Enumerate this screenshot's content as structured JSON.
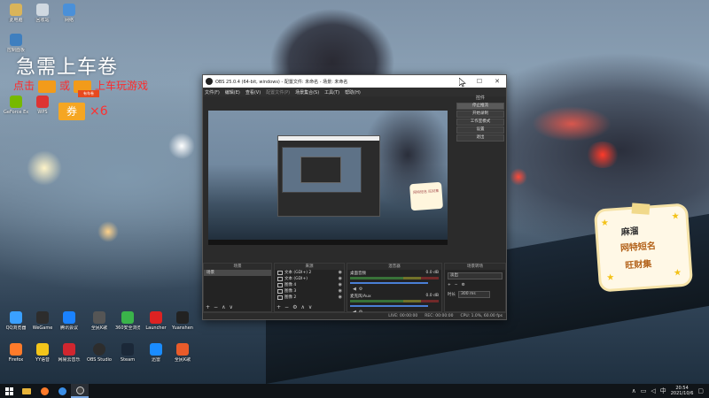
{
  "desktop": {
    "icons": [
      {
        "label": "此电脑",
        "color": "#d9b45a"
      },
      {
        "label": "回收站",
        "color": "#cfd8e0"
      },
      {
        "label": "网络",
        "color": "#4a90d9"
      },
      {
        "label": "控制面板",
        "color": "#3f7fbf"
      },
      {
        "label": "GeForce Experience",
        "color": "#76b900"
      },
      {
        "label": "WPS",
        "color": "#d33"
      },
      {
        "label": "QQ浏览器",
        "color": "#3aa0ff"
      },
      {
        "label": "WeGame",
        "color": "#2d2d2d"
      },
      {
        "label": "腾讯会议",
        "color": "#1a82ff"
      },
      {
        "label": "全民K歌",
        "color": "#555"
      },
      {
        "label": "360安全浏览器",
        "color": "#3ab34a"
      },
      {
        "label": "Launcher",
        "color": "#d22"
      },
      {
        "label": "Yuanshen",
        "color": "#222"
      },
      {
        "label": "Firefox",
        "color": "#ff7b2a"
      },
      {
        "label": "YY语音",
        "color": "#f3c51a"
      },
      {
        "label": "网易云音乐",
        "color": "#d0262f"
      },
      {
        "label": "OBS Studio",
        "color": "#2d2d2d"
      },
      {
        "label": "Steam",
        "color": "#1b2838"
      },
      {
        "label": "迅雷",
        "color": "#1a8cff"
      },
      {
        "label": "全民K歌",
        "color": "#e95b2a"
      }
    ]
  },
  "promo": {
    "title": "急需上车卷",
    "line_left": "点击",
    "line_mid": "或",
    "line_right": "上车玩游戏",
    "badge_sub": "有车卷",
    "ticket": "券",
    "count": "×6"
  },
  "sticker": {
    "line1": "麻溜",
    "line2": "网特短名",
    "line3": "旺财集"
  },
  "obs": {
    "title": "OBS 25.0.4 (64-bit, windows) - 配置文件: 未命名 - 场景: 未命名",
    "menu": [
      "文件(F)",
      "编辑(E)",
      "查看(V)",
      "配置文件(P)",
      "场景集合(S)",
      "工具(T)",
      "帮助(H)"
    ],
    "controls_header": "控件",
    "controls": [
      "停止推流",
      "开始录制",
      "工作室模式",
      "设置",
      "退出"
    ],
    "scenes": {
      "header": "场景",
      "items": [
        "场景"
      ]
    },
    "sources": {
      "header": "来源",
      "items": [
        "文本 (GDI+) 2",
        "文本 (GDI+)",
        "图像 4",
        "图像 3",
        "图像 2",
        "图像"
      ]
    },
    "mixer": {
      "header": "混音器",
      "channels": [
        {
          "name": "桌面音频",
          "db": "0.0 dB"
        },
        {
          "name": "麦克风/Aux",
          "db": "0.0 dB"
        }
      ]
    },
    "transitions": {
      "header": "场景转场",
      "selected": "淡出",
      "duration_label": "时长",
      "duration": "300 ms"
    },
    "status": {
      "live": "LIVE: 00:00:00",
      "rec": "REC: 00:00:00",
      "cpu": "CPU: 1.0%, 60.00 fps"
    },
    "preview_sticker": "网特短名\n旺财集"
  },
  "taskbar": {
    "items": [
      "start",
      "explorer",
      "firefox",
      "edge",
      "obs"
    ],
    "time": "20:54",
    "date": "2021/10/6"
  }
}
